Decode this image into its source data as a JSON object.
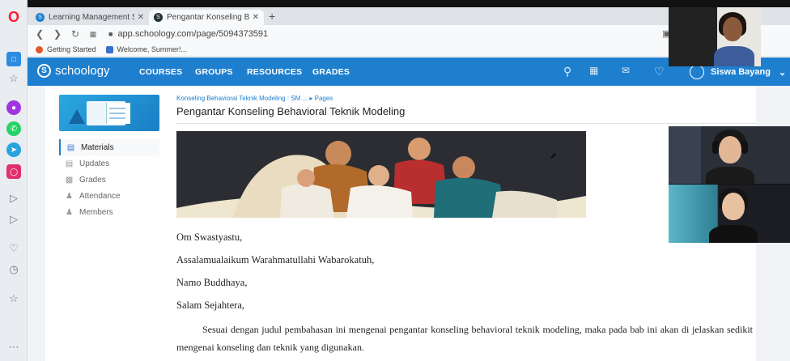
{
  "browser": {
    "tabs": [
      {
        "title": "Learning Management Sys",
        "active": false
      },
      {
        "title": "Pengantar Konseling Beha",
        "active": true
      }
    ],
    "new_tab_symbol": "+",
    "url": "app.schoology.com/page/5094373591",
    "bookmarks": [
      "Getting Started",
      "Welcome, Summer!..."
    ]
  },
  "header": {
    "logo_text": "schoology",
    "nav": [
      "COURSES",
      "GROUPS",
      "RESOURCES",
      "GRADES"
    ],
    "icons": [
      "search-icon",
      "calendar-icon",
      "mail-icon",
      "notifications-icon"
    ],
    "user_name": "Siswa Bayang",
    "accent_color": "#1e7fcf"
  },
  "sidebar": {
    "items": [
      {
        "label": "Materials",
        "icon": "materials-icon",
        "active": true
      },
      {
        "label": "Updates",
        "icon": "updates-icon",
        "active": false
      },
      {
        "label": "Grades",
        "icon": "grades-icon",
        "active": false
      },
      {
        "label": "Attendance",
        "icon": "attendance-icon",
        "active": false
      },
      {
        "label": "Members",
        "icon": "members-icon",
        "active": false
      }
    ]
  },
  "main": {
    "breadcrumb": "Konseling Behavioral Teknik Modeling : SM ... ▸ Pages",
    "title": "Pengantar Konseling Behavioral Teknik Modeling",
    "greetings": [
      "Om Swastyastu,",
      "Assalamualaikum Warahmatullahi Wabarokatuh,",
      "Namo Buddhaya,",
      "Salam Sejahtera,"
    ],
    "paragraph": "Sesuai dengan judul pembahasan ini mengenai pengantar konseling behavioral teknik modeling, maka pada bab ini akan di jelaskan sedikit mengenai konseling dan teknik yang digunakan."
  }
}
